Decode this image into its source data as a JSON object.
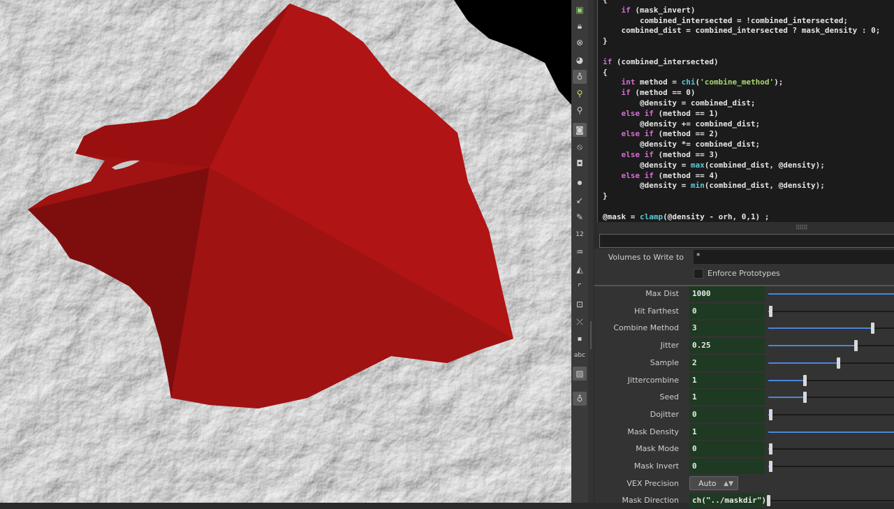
{
  "code": {
    "lines": [
      [
        {
          "t": "{"
        }
      ],
      [
        {
          "t": "    "
        },
        {
          "t": "if",
          "k": "kw"
        },
        {
          "t": " (mask_invert)"
        }
      ],
      [
        {
          "t": "        combined_intersected = !combined_intersected;"
        }
      ],
      [
        {
          "t": "    combined_dist = combined_intersected ? mask_density : 0;"
        }
      ],
      [
        {
          "t": "}"
        }
      ],
      [
        {
          "t": ""
        }
      ],
      [
        {
          "t": "if",
          "k": "kw"
        },
        {
          "t": " (combined_intersected)"
        }
      ],
      [
        {
          "t": "{"
        }
      ],
      [
        {
          "t": "    "
        },
        {
          "t": "int",
          "k": "kw"
        },
        {
          "t": " method = "
        },
        {
          "t": "chi",
          "k": "fn"
        },
        {
          "t": "("
        },
        {
          "t": "'combine_method'",
          "k": "str"
        },
        {
          "t": ");"
        }
      ],
      [
        {
          "t": "    "
        },
        {
          "t": "if",
          "k": "kw"
        },
        {
          "t": " (method == 0)"
        }
      ],
      [
        {
          "t": "        @density = combined_dist;"
        }
      ],
      [
        {
          "t": "    "
        },
        {
          "t": "else if",
          "k": "kw"
        },
        {
          "t": " (method == 1)"
        }
      ],
      [
        {
          "t": "        @density += combined_dist;"
        }
      ],
      [
        {
          "t": "    "
        },
        {
          "t": "else if",
          "k": "kw"
        },
        {
          "t": " (method == 2)"
        }
      ],
      [
        {
          "t": "        @density *= combined_dist;"
        }
      ],
      [
        {
          "t": "    "
        },
        {
          "t": "else if",
          "k": "kw"
        },
        {
          "t": " (method == 3)"
        }
      ],
      [
        {
          "t": "        @density = "
        },
        {
          "t": "max",
          "k": "fn"
        },
        {
          "t": "(combined_dist, @density);"
        }
      ],
      [
        {
          "t": "    "
        },
        {
          "t": "else if",
          "k": "kw"
        },
        {
          "t": " (method == 4)"
        }
      ],
      [
        {
          "t": "        @density = "
        },
        {
          "t": "min",
          "k": "fn"
        },
        {
          "t": "(combined_dist, @density);"
        }
      ],
      [
        {
          "t": "}"
        }
      ],
      [
        {
          "t": ""
        }
      ],
      [
        {
          "t": "@mask = "
        },
        {
          "t": "clamp",
          "k": "fn"
        },
        {
          "t": "(@density - orh, 0,1) ;"
        }
      ]
    ]
  },
  "volumes_label": "Volumes to Write to",
  "volumes_value": "*",
  "enforce_label": "Enforce Prototypes",
  "parms": [
    {
      "label": "Max Dist",
      "value": "1000",
      "slider": 1.0
    },
    {
      "label": "Hit Farthest",
      "value": "0",
      "slider": 0.0
    },
    {
      "label": "Combine Method",
      "value": "3",
      "slider": 0.9
    },
    {
      "label": "Jitter",
      "value": "0.25",
      "slider": 0.75
    },
    {
      "label": "Sample",
      "value": "2",
      "slider": 0.6
    },
    {
      "label": "Jittercombine",
      "value": "1",
      "slider": 0.3
    },
    {
      "label": "Seed",
      "value": "1",
      "slider": 0.3
    },
    {
      "label": "Dojitter",
      "value": "0",
      "slider": 0.0
    },
    {
      "label": "Mask Density",
      "value": "1",
      "slider": 1.0
    },
    {
      "label": "Mask Mode",
      "value": "0",
      "slider": 0.0
    },
    {
      "label": "Mask Invert",
      "value": "0",
      "slider": 0.0
    }
  ],
  "vex_label": "VEX Precision",
  "vex_value": "Auto",
  "mask_dir_label": "Mask Direction",
  "mask_dir_value": "ch(\"../maskdir\")",
  "toolbar_text": {
    "num": "12",
    "abc": "abc"
  },
  "colors": {
    "mesh": "#b01414",
    "field": "#1e3a22",
    "slider_fill": "#4a86d8"
  }
}
